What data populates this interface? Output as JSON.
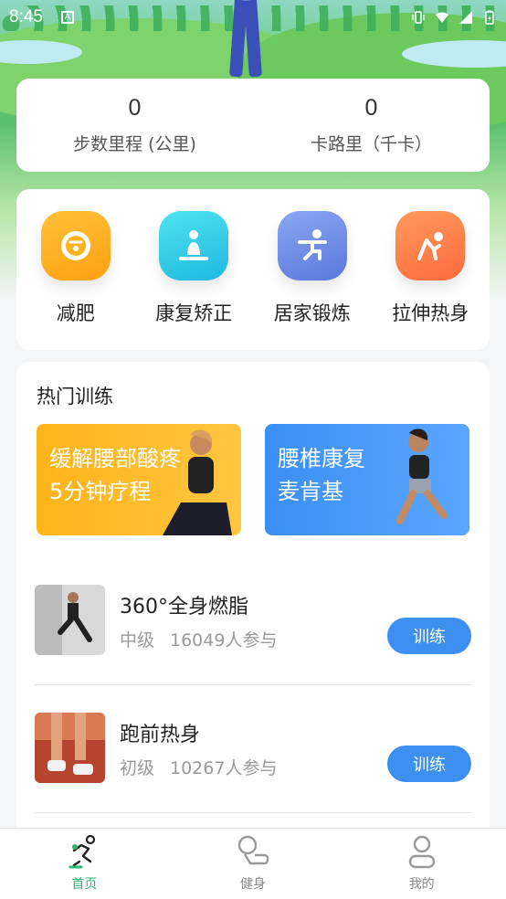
{
  "status_bar": {
    "time": "8:45",
    "notification_badge": "A"
  },
  "stats": [
    {
      "value": "0",
      "label": "步数里程 (公里)"
    },
    {
      "value": "0",
      "label": "卡路里（千卡）"
    }
  ],
  "categories": [
    {
      "label": "减肥",
      "icon": "scale-icon",
      "color": "#ffb21c"
    },
    {
      "label": "康复矫正",
      "icon": "meditation-icon",
      "color": "#2fd0e8"
    },
    {
      "label": "居家锻炼",
      "icon": "squat-icon",
      "color": "#6f8ee8"
    },
    {
      "label": "拉伸热身",
      "icon": "stretch-icon",
      "color": "#ff7a4a"
    }
  ],
  "hot_section": {
    "title": "热门训练",
    "banners": [
      {
        "line1": "缓解腰部酸疼",
        "line2": "5分钟疗程",
        "color": "#ffb31a"
      },
      {
        "line1": "腰椎康复",
        "line2": "麦肯基",
        "color": "#3b8ff2"
      }
    ],
    "items": [
      {
        "name": "360°全身燃脂",
        "level": "中级",
        "participants": "16049人参与",
        "button": "训练"
      },
      {
        "name": "跑前热身",
        "level": "初级",
        "participants": "10267人参与",
        "button": "训练"
      }
    ]
  },
  "bottom_nav": [
    {
      "label": "首页",
      "icon": "run-icon",
      "active": true
    },
    {
      "label": "健身",
      "icon": "fitness-icon",
      "active": false
    },
    {
      "label": "我的",
      "icon": "profile-icon",
      "active": false
    }
  ],
  "colors": {
    "accent": "#3d8ff0",
    "active_nav": "#2bb673"
  }
}
